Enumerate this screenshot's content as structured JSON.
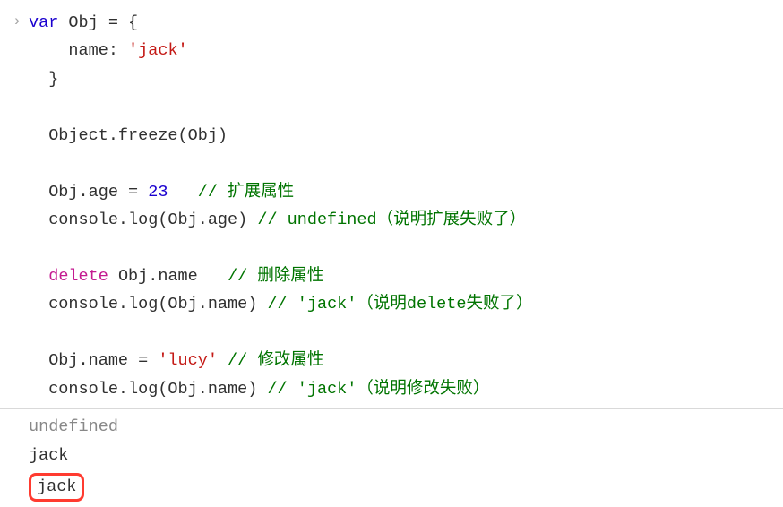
{
  "code": {
    "l1": "var",
    "l1b": " Obj = {",
    "l2": "    name: ",
    "l2s": "'jack'",
    "l3": "  }",
    "l5": "  Object.freeze(Obj)",
    "l7": "  Obj.age = ",
    "l7n": "23",
    "l7c": "   // 扩展属性",
    "l8": "  console.log(Obj.age) ",
    "l8c": "// undefined（说明扩展失败了）",
    "l10": "delete",
    "l10b": " Obj.name   ",
    "l10c": "// 删除属性",
    "l11": "  console.log(Obj.name) ",
    "l11c": "// 'jack'（说明delete失败了）",
    "l13": "  Obj.name = ",
    "l13s": "'lucy'",
    "l13c": " // 修改属性",
    "l14": "  console.log(Obj.name) ",
    "l14c": "// 'jack'（说明修改失败）"
  },
  "output": {
    "undefined_label": "undefined",
    "line1": "jack",
    "line2": "jack"
  },
  "prompt_glyph": "›"
}
